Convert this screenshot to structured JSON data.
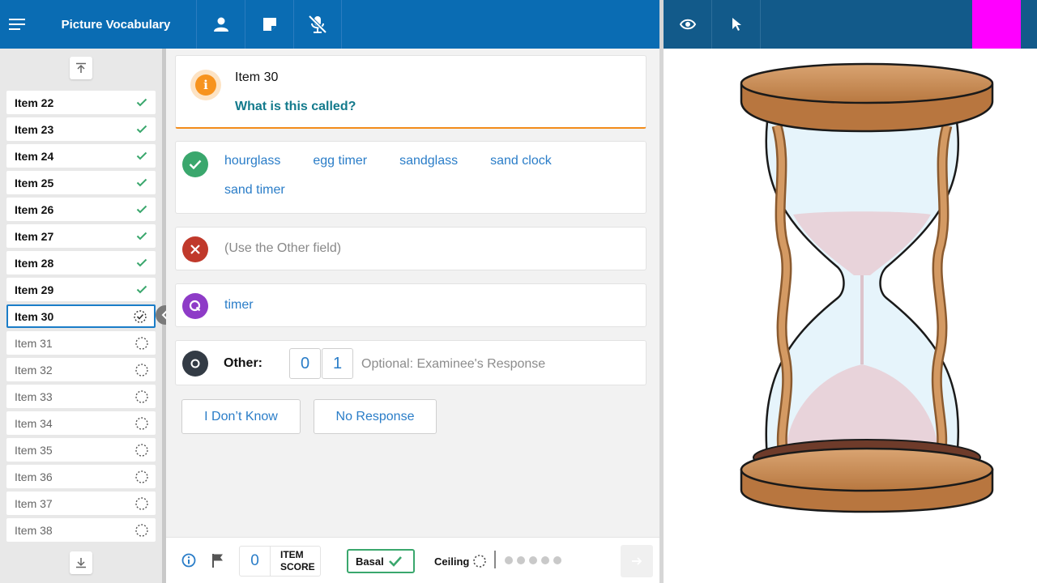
{
  "app": {
    "title": "Picture Vocabulary"
  },
  "toolbar": {
    "icons": [
      "menu-icon",
      "person-icon",
      "note-icon",
      "microphone-off-icon"
    ],
    "right_icons": [
      "eye-icon",
      "cursor-icon"
    ],
    "marker_color": "#ff00ff"
  },
  "sidebar": {
    "items": [
      {
        "label": "Item 22",
        "status": "done"
      },
      {
        "label": "Item 23",
        "status": "done"
      },
      {
        "label": "Item 24",
        "status": "done"
      },
      {
        "label": "Item 25",
        "status": "done"
      },
      {
        "label": "Item 26",
        "status": "done"
      },
      {
        "label": "Item 27",
        "status": "done"
      },
      {
        "label": "Item 28",
        "status": "done"
      },
      {
        "label": "Item 29",
        "status": "done"
      },
      {
        "label": "Item 30",
        "status": "current"
      },
      {
        "label": "Item 31",
        "status": "todo"
      },
      {
        "label": "Item 32",
        "status": "todo"
      },
      {
        "label": "Item 33",
        "status": "todo"
      },
      {
        "label": "Item 34",
        "status": "todo"
      },
      {
        "label": "Item 35",
        "status": "todo"
      },
      {
        "label": "Item 36",
        "status": "todo"
      },
      {
        "label": "Item 37",
        "status": "todo"
      },
      {
        "label": "Item 38",
        "status": "todo"
      }
    ]
  },
  "prompt": {
    "item_title": "Item 30",
    "question": "What is this called?"
  },
  "responses": {
    "correct": [
      "hourglass",
      "egg timer",
      "sandglass",
      "sand clock",
      "sand timer"
    ],
    "incorrect": "(Use the Other field)",
    "query": "timer",
    "other_label": "Other:",
    "score_options": [
      "0",
      "1"
    ],
    "other_placeholder": "Optional: Examinee's Response"
  },
  "actions": {
    "dont_know": "I Don’t Know",
    "no_response": "No Response"
  },
  "footer": {
    "item_score_value": "0",
    "item_score_label_1": "ITEM",
    "item_score_label_2": "SCORE",
    "basal_label": "Basal",
    "ceiling_label": "Ceiling"
  },
  "colors": {
    "header": "#0a6cb3",
    "correct": "#3aa76d",
    "incorrect": "#c0392b",
    "query": "#8e3bc7",
    "accent_orange": "#f7931e"
  },
  "stimulus": {
    "image": "hourglass-illustration"
  }
}
